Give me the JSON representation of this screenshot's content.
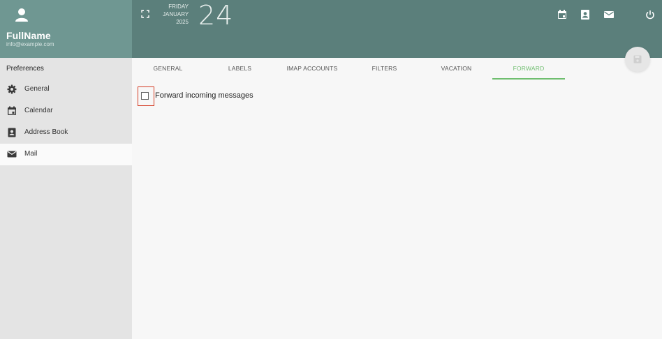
{
  "user": {
    "name": "FullName",
    "email": "info@example.com"
  },
  "date": {
    "weekday": "FRIDAY",
    "month": "JANUARY",
    "year": "2025",
    "day": "24"
  },
  "header_icons": [
    "calendar-icon",
    "contacts-icon",
    "mail-icon",
    "power-icon"
  ],
  "sidebar": {
    "title": "Preferences",
    "items": [
      {
        "label": "General",
        "icon": "gear-icon"
      },
      {
        "label": "Calendar",
        "icon": "calendar-icon"
      },
      {
        "label": "Address Book",
        "icon": "contacts-icon"
      },
      {
        "label": "Mail",
        "icon": "mail-icon",
        "active": true
      }
    ]
  },
  "tabs": [
    {
      "label": "GENERAL"
    },
    {
      "label": "LABELS"
    },
    {
      "label": "IMAP ACCOUNTS"
    },
    {
      "label": "FILTERS"
    },
    {
      "label": "VACATION"
    },
    {
      "label": "FORWARD",
      "active": true
    }
  ],
  "forward": {
    "label": "Forward incoming messages",
    "checked": false
  },
  "colors": {
    "header_left": "#6f9792",
    "header_right": "#5b7f7b",
    "accent": "#6fbe6f",
    "highlight": "#d43b22"
  }
}
